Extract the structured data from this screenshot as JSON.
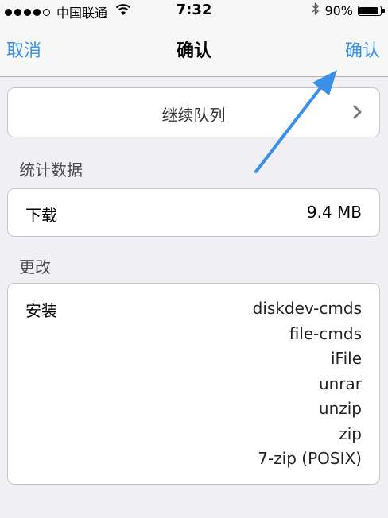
{
  "status_bar": {
    "carrier": "中国联通",
    "time": "7:32",
    "battery_text": "90%",
    "battery_level": 0.9,
    "signal_bars": 4,
    "signal_total": 5
  },
  "nav": {
    "left_button": "取消",
    "title": "确认",
    "right_button": "确认",
    "accent_color": "#3a93e5"
  },
  "queue": {
    "label": "继续队列"
  },
  "statistics": {
    "header": "统计数据",
    "download_label": "下载",
    "download_value": "9.4 MB"
  },
  "changes": {
    "header": "更改",
    "install_label": "安装",
    "packages": [
      "diskdev-cmds",
      "file-cmds",
      "iFile",
      "unrar",
      "unzip",
      "zip",
      "7-zip (POSIX)"
    ]
  },
  "annotation": {
    "arrow_color": "#3a8fe8"
  }
}
